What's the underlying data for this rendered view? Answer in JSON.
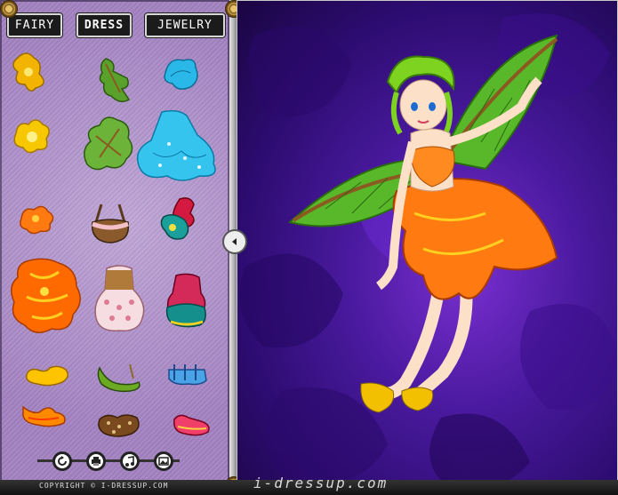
{
  "tabs": [
    {
      "label": "FAIRY",
      "active": false
    },
    {
      "label": "DRESS",
      "active": true
    },
    {
      "label": "JEWELRY",
      "active": false
    }
  ],
  "footer": {
    "copyright": "COPYRIGHT © I-DRESSUP.COM",
    "site_logo": "i-dressup.com"
  },
  "controls": [
    {
      "name": "reset-button",
      "icon": "refresh-icon"
    },
    {
      "name": "print-button",
      "icon": "printer-icon"
    },
    {
      "name": "music-button",
      "icon": "music-icon"
    },
    {
      "name": "save-image-button",
      "icon": "picture-icon"
    }
  ],
  "wardrobe_items": [
    {
      "name": "orange-flower-hair-small",
      "color": "#f2b400"
    },
    {
      "name": "green-leaf-top",
      "color": "#5aa12c"
    },
    {
      "name": "blue-wing-top",
      "color": "#2ab8e8"
    },
    {
      "name": "yellow-flower-top",
      "color": "#f7c800"
    },
    {
      "name": "green-leaf-skirt",
      "color": "#6cb33a"
    },
    {
      "name": "blue-frill-skirt",
      "color": "#35c4ee"
    },
    {
      "name": "orange-flower-top",
      "color": "#ff7a10"
    },
    {
      "name": "pink-basket-top",
      "color": "#f4c0c8"
    },
    {
      "name": "teal-red-top",
      "color": "#1a9f9a"
    },
    {
      "name": "orange-flame-skirt",
      "color": "#ff6a00"
    },
    {
      "name": "pink-polka-skirt",
      "color": "#f5dde2"
    },
    {
      "name": "teal-ruffle-skirt",
      "color": "#148f8c"
    },
    {
      "name": "yellow-shoes",
      "color": "#ffc400"
    },
    {
      "name": "green-vine-shoes",
      "color": "#6caa24"
    },
    {
      "name": "blue-strap-shoes",
      "color": "#4aa3e6"
    },
    {
      "name": "orange-flame-shoes",
      "color": "#ff8a00"
    },
    {
      "name": "brown-dotted-shoes",
      "color": "#7a4a1e"
    },
    {
      "name": "pink-red-shoes",
      "color": "#f0406a"
    }
  ]
}
